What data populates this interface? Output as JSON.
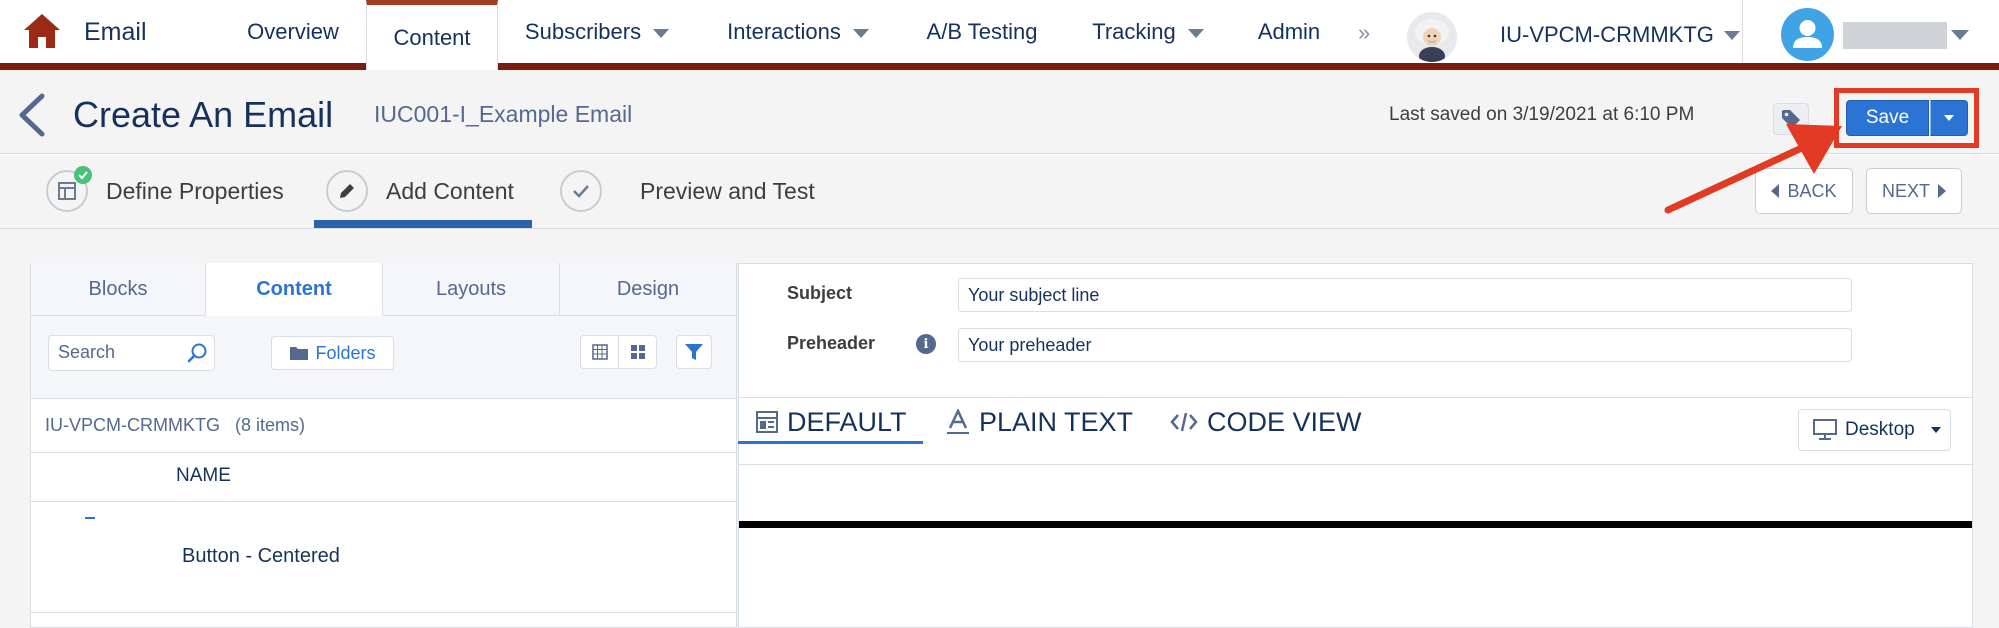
{
  "nav": {
    "app_title": "Email",
    "tabs": [
      {
        "label": "Overview",
        "has_menu": false,
        "active": false
      },
      {
        "label": "Content",
        "has_menu": false,
        "active": true
      },
      {
        "label": "Subscribers",
        "has_menu": true,
        "active": false
      },
      {
        "label": "Interactions",
        "has_menu": true,
        "active": false
      },
      {
        "label": "A/B Testing",
        "has_menu": false,
        "active": false
      },
      {
        "label": "Tracking",
        "has_menu": true,
        "active": false
      },
      {
        "label": "Admin",
        "has_menu": false,
        "active": false
      }
    ],
    "more_glyph": "»",
    "business_unit": "IU-VPCM-CRMMKTG",
    "colors": {
      "accent_bar": "#7a1d0f",
      "home_icon": "#9a2a14"
    }
  },
  "header": {
    "title": "Create An Email",
    "email_name": "IUC001-I_Example Email",
    "last_saved": "Last saved on 3/19/2021 at 6:10 PM",
    "save_label": "Save",
    "highlight_color": "#e23a23"
  },
  "steps": [
    {
      "label": "Define Properties",
      "state": "complete"
    },
    {
      "label": "Add Content",
      "state": "active"
    },
    {
      "label": "Preview and Test",
      "state": "pending"
    }
  ],
  "pager": {
    "back_label": "BACK",
    "next_label": "NEXT"
  },
  "left_panel": {
    "tabs": [
      {
        "label": "Blocks",
        "active": false
      },
      {
        "label": "Content",
        "active": true
      },
      {
        "label": "Layouts",
        "active": false
      },
      {
        "label": "Design",
        "active": false
      }
    ],
    "search_placeholder": "Search",
    "folders_label": "Folders",
    "folder_path": "IU-VPCM-CRMMKTG",
    "item_count": "(8 items)",
    "column_header": "NAME",
    "items": [
      {
        "name": "Button - Centered"
      }
    ]
  },
  "editor": {
    "subject_label": "Subject",
    "subject_value": "Your subject line",
    "preheader_label": "Preheader",
    "preheader_value": "Your preheader",
    "view_tabs": [
      {
        "label": "DEFAULT",
        "icon": "layout-icon",
        "active": true
      },
      {
        "label": "PLAIN TEXT",
        "icon": "text-format-icon",
        "active": false
      },
      {
        "label": "CODE VIEW",
        "icon": "code-icon",
        "active": false
      }
    ],
    "device_label": "Desktop"
  }
}
